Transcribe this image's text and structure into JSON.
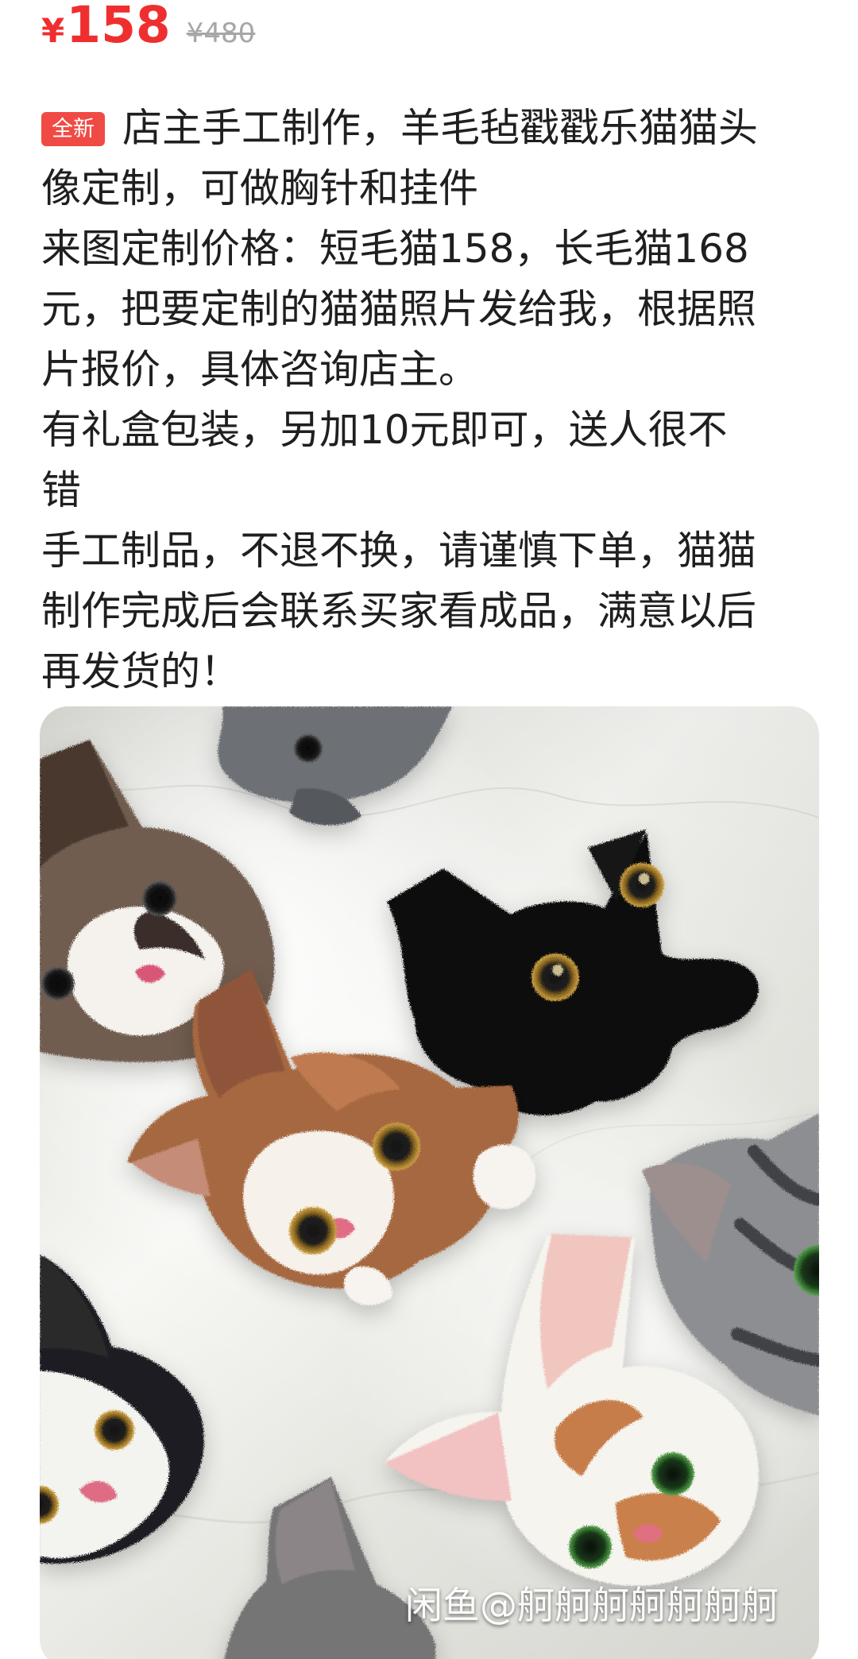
{
  "price": {
    "currency": "¥",
    "current": "158",
    "original": "¥480"
  },
  "listing": {
    "badge": "全新",
    "description_lines": [
      "店主手工制作，羊毛毡戳戳乐猫猫头",
      "像定制，可做胸针和挂件",
      "来图定制价格：短毛猫158，长毛猫168",
      "元，把要定制的猫猫照片发给我，根据照",
      "片报价，具体咨询店主。",
      "有礼盒包装，另加10元即可，送人很不",
      "错",
      "手工制品，不退不换，请谨慎下单，猫猫",
      "制作完成后会联系买家看成品，满意以后",
      "再发货的！"
    ]
  },
  "image": {
    "watermark": "闲鱼@舸舸舸舸舸舸舸"
  },
  "colors": {
    "price_red": "#ef2f2f",
    "badge_red": "#f04a44",
    "text": "#1f1f1f",
    "muted": "#a7a7a7"
  }
}
